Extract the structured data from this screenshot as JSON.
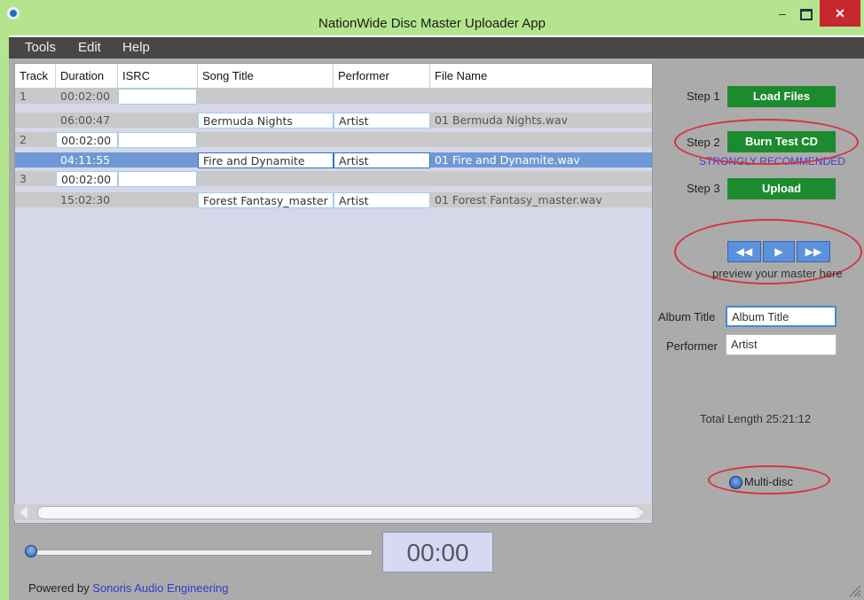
{
  "window": {
    "title": "NationWide Disc Master Uploader App",
    "controls": {
      "minimize": "–",
      "close": "✕"
    }
  },
  "menu": [
    "Tools",
    "Edit",
    "Help"
  ],
  "table": {
    "columns": [
      "Track",
      "Duration",
      "ISRC",
      "Song Title",
      "Performer",
      "File Name"
    ],
    "rows": [
      {
        "track": "1",
        "duration": "00:02:00",
        "isrc": "",
        "title": "",
        "performer": "",
        "file": "",
        "kind": "pregap"
      },
      {
        "track": "",
        "duration": "06:00:47",
        "isrc": "",
        "title": "Bermuda Nights",
        "performer": "Artist",
        "file": "01 Bermuda Nights.wav",
        "kind": "song"
      },
      {
        "track": "2",
        "duration": "00:02:00",
        "isrc": "",
        "title": "",
        "performer": "",
        "file": "",
        "kind": "pregap"
      },
      {
        "track": "",
        "duration": "04:11:55",
        "isrc": "",
        "title": "Fire and Dynamite",
        "performer": "Artist",
        "file": "01 Fire and Dynamite.wav",
        "kind": "song",
        "selected": true
      },
      {
        "track": "3",
        "duration": "00:02:00",
        "isrc": "",
        "title": "",
        "performer": "",
        "file": "",
        "kind": "pregap"
      },
      {
        "track": "",
        "duration": "15:02:30",
        "isrc": "",
        "title": "Forest Fantasy_master",
        "performer": "Artist",
        "file": "01 Forest Fantasy_master.wav",
        "kind": "song"
      }
    ]
  },
  "steps": [
    {
      "label": "Step 1",
      "button": "Load Files"
    },
    {
      "label": "Step 2",
      "button": "Burn Test CD",
      "note": "STRONGLY RECOMMENDED"
    },
    {
      "label": "Step 3",
      "button": "Upload"
    }
  ],
  "transport": {
    "rewind": "◀◀",
    "play": "▶",
    "forward": "▶▶",
    "caption": "preview your master here"
  },
  "album": {
    "title_label": "Album Title",
    "title_value": "Album Title",
    "performer_label": "Performer",
    "performer_value": "Artist"
  },
  "total_length": "Total Length  25:21:12",
  "multi_disc": {
    "label": "Multi-disc",
    "checked": true
  },
  "player": {
    "time": "00:00",
    "position": 0
  },
  "footer": {
    "prefix": "Powered by",
    "link": "Sonoris Audio Engineering"
  },
  "colors": {
    "title_bar": "#b4e58e",
    "menu_bar": "#474747",
    "green_button": "#1c8b2e",
    "selection": "#6e99d6",
    "highlight_circle": "#d8323c"
  }
}
